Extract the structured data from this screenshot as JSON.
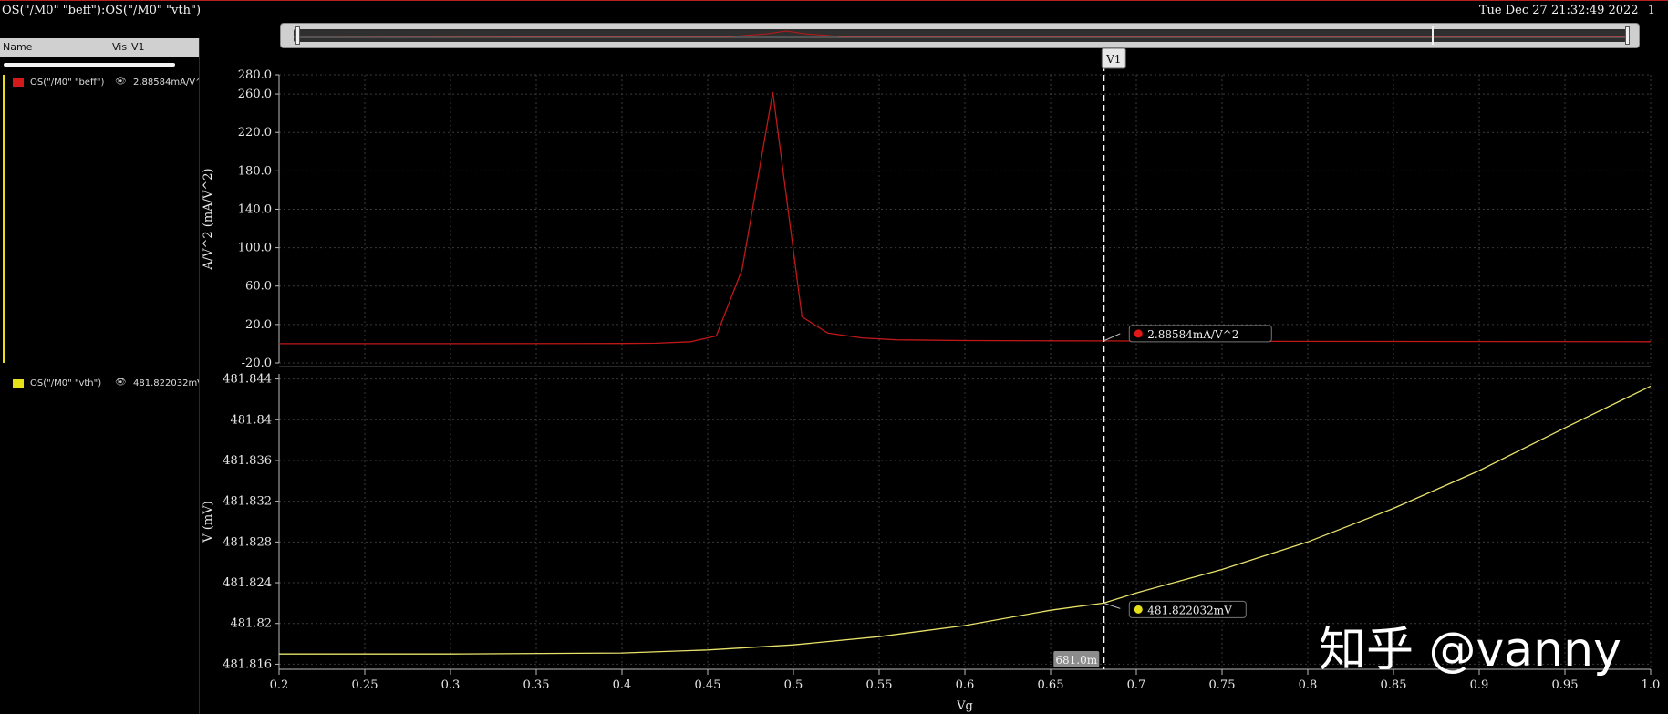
{
  "window": {
    "title": "OS(\"/M0\" \"beff\"):OS(\"/M0\" \"vth\")",
    "datetime": "Tue Dec 27 21:32:49 2022",
    "page": "1"
  },
  "legend": {
    "headers": {
      "name": "Name",
      "vis": "Vis",
      "v1": "V1"
    },
    "items": [
      {
        "name": "OS(\"/M0\" \"beff\")",
        "value": "2.88584mA/V^2",
        "color": "#d21a1a"
      },
      {
        "name": "OS(\"/M0\" \"vth\")",
        "value": "481.822032mV",
        "color": "#e6e018"
      }
    ]
  },
  "colors": {
    "beff": "#c01818",
    "vth": "#e8e26a",
    "grid": "#3a3a3a",
    "cursor": "#ffffff"
  },
  "cursor": {
    "label": "V1",
    "x": 0.681,
    "x_label": "681.0m",
    "beff_readout": "2.88584mA/V^2",
    "vth_readout": "481.822032mV"
  },
  "watermark": "知乎 @vanny",
  "chart_data": [
    {
      "type": "line",
      "ylabel": "A/V^2 (mA/V^2)",
      "ylim": [
        -20,
        280
      ],
      "yticks": [
        "-20.0",
        "20.0",
        "60.0",
        "100.0",
        "140.0",
        "180.0",
        "220.0",
        "260.0",
        "280.0"
      ],
      "ytick_values": [
        -20,
        20,
        60,
        100,
        140,
        180,
        220,
        260,
        280
      ],
      "grid": true,
      "series": [
        {
          "name": "OS(\"/M0\" \"beff\")",
          "x": [
            0.2,
            0.3,
            0.4,
            0.42,
            0.44,
            0.455,
            0.47,
            0.488,
            0.505,
            0.52,
            0.54,
            0.56,
            0.6,
            0.65,
            0.681,
            0.75,
            0.85,
            1.0
          ],
          "y": [
            0,
            0,
            0.2,
            0.5,
            2,
            8,
            77,
            262,
            28,
            11,
            6,
            4,
            3.3,
            3,
            2.886,
            2.5,
            2.3,
            2.0
          ]
        }
      ]
    },
    {
      "type": "line",
      "xlabel": "Vg",
      "ylabel": "V (mV)",
      "xlim": [
        0.2,
        1.0
      ],
      "ylim": [
        481.8155,
        481.8445
      ],
      "xticks": [
        "0.2",
        "0.25",
        "0.3",
        "0.35",
        "0.4",
        "0.45",
        "0.5",
        "0.55",
        "0.6",
        "0.65",
        "0.7",
        "0.75",
        "0.8",
        "0.85",
        "0.9",
        "0.95",
        "1.0"
      ],
      "yticks": [
        "481.816",
        "481.82",
        "481.824",
        "481.828",
        "481.832",
        "481.836",
        "481.84",
        "481.844"
      ],
      "ytick_values": [
        481.816,
        481.82,
        481.824,
        481.828,
        481.832,
        481.836,
        481.84,
        481.844
      ],
      "grid": true,
      "series": [
        {
          "name": "OS(\"/M0\" \"vth\")",
          "x": [
            0.2,
            0.3,
            0.4,
            0.45,
            0.5,
            0.55,
            0.6,
            0.65,
            0.681,
            0.7,
            0.75,
            0.8,
            0.85,
            0.9,
            0.95,
            1.0
          ],
          "y": [
            481.817,
            481.817,
            481.8171,
            481.8174,
            481.8179,
            481.8187,
            481.8198,
            481.8213,
            481.822,
            481.823,
            481.8253,
            481.828,
            481.8313,
            481.835,
            481.8392,
            481.8433
          ]
        }
      ]
    }
  ]
}
